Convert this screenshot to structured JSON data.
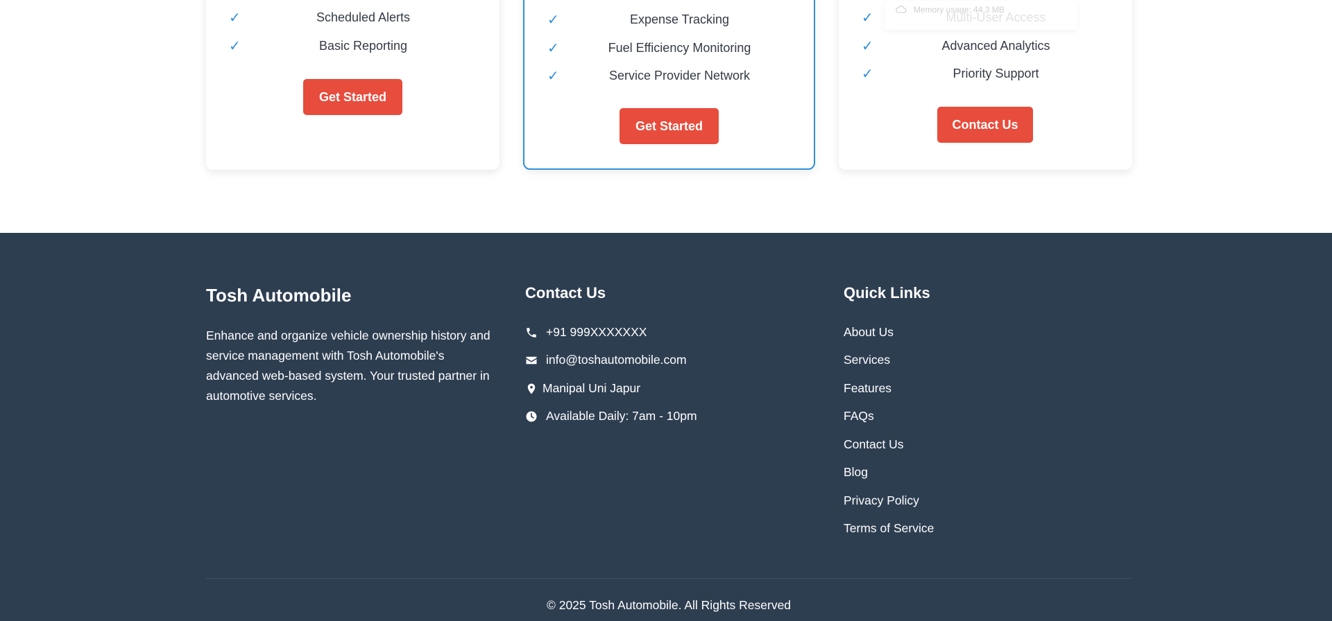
{
  "pricing": {
    "cards": [
      {
        "features": [
          "Scheduled Alerts",
          "Basic Reporting"
        ],
        "button_label": "Get Started"
      },
      {
        "features": [
          "Expense Tracking",
          "Fuel Efficiency Monitoring",
          "Service Provider Network"
        ],
        "button_label": "Get Started"
      },
      {
        "features": [
          "Multi-User Access",
          "Advanced Analytics",
          "Priority Support"
        ],
        "button_label": "Contact Us"
      }
    ],
    "check_glyph": "✓",
    "accent_color": "#2f8fdc",
    "button_color": "#e74c3c"
  },
  "overlay": {
    "text": "Memory usage: 44.3 MB"
  },
  "footer": {
    "background_color": "#2e3e51",
    "brand": {
      "title": "Tosh Automobile",
      "description": "Enhance and organize vehicle ownership history and service management with Tosh Automobile's advanced web-based system. Your trusted partner in automotive services."
    },
    "contact": {
      "title": "Contact Us",
      "phone": "+91 999XXXXXXX",
      "email": "info@toshautomobile.com",
      "location": "Manipal Uni Japur",
      "hours": "Available Daily: 7am - 10pm",
      "icons": [
        "phone-icon",
        "envelope-icon",
        "map-pin-icon",
        "clock-icon"
      ]
    },
    "quick_links": {
      "title": "Quick Links",
      "items": [
        "About Us",
        "Services",
        "Features",
        "FAQs",
        "Contact Us",
        "Blog",
        "Privacy Policy",
        "Terms of Service"
      ]
    },
    "copyright": "© 2025 Tosh Automobile. All Rights Reserved"
  }
}
